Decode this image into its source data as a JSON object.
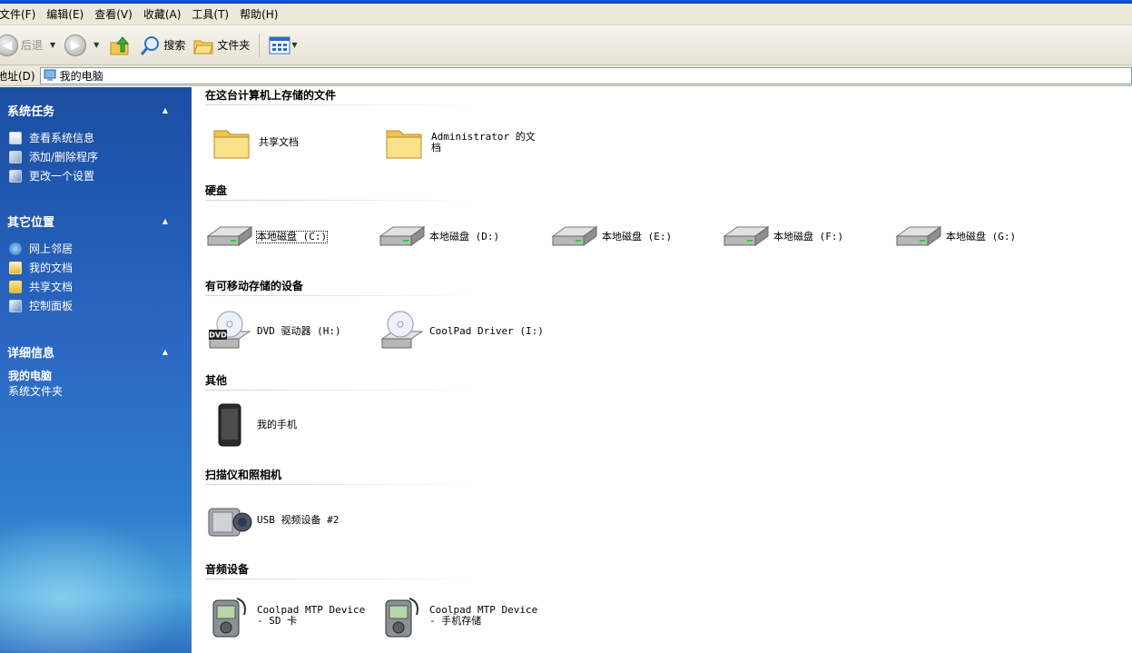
{
  "menu": [
    "文件(F)",
    "编辑(E)",
    "查看(V)",
    "收藏(A)",
    "工具(T)",
    "帮助(H)"
  ],
  "toolbar": {
    "back_label": "后退",
    "search_label": "搜索",
    "folders_label": "文件夹"
  },
  "address": {
    "label": "地址(D)",
    "value": "我的电脑"
  },
  "left_pane": {
    "system_tasks": {
      "title": "系统任务",
      "items": [
        "查看系统信息",
        "添加/删除程序",
        "更改一个设置"
      ]
    },
    "other_places": {
      "title": "其它位置",
      "items": [
        "网上邻居",
        "我的文档",
        "共享文档",
        "控制面板"
      ]
    },
    "details": {
      "title": "详细信息",
      "name": "我的电脑",
      "type": "系统文件夹"
    }
  },
  "groups": [
    {
      "title": "在这台计算机上存储的文件",
      "items": [
        "共享文档",
        "Administrator 的文档"
      ]
    },
    {
      "title": "硬盘",
      "items": [
        "本地磁盘 (C:)",
        "本地磁盘 (D:)",
        "本地磁盘 (E:)",
        "本地磁盘 (F:)",
        "本地磁盘 (G:)"
      ]
    },
    {
      "title": "有可移动存储的设备",
      "items": [
        "DVD 驱动器 (H:)",
        "CoolPad Driver (I:)"
      ]
    },
    {
      "title": "其他",
      "items": [
        "我的手机"
      ]
    },
    {
      "title": "扫描仪和照相机",
      "items": [
        "USB 视频设备 #2"
      ]
    },
    {
      "title": "音频设备",
      "items": [
        "Coolpad MTP Device - SD 卡",
        "Coolpad MTP Device - 手机存储"
      ]
    }
  ],
  "icons": {
    "folder": "folder-icon",
    "drive": "hard-drive-icon",
    "dvd": "dvd-drive-icon",
    "cd": "cd-drive-icon",
    "phone": "phone-icon",
    "camera": "camera-icon",
    "mp3": "mp3-player-icon"
  },
  "colors": {
    "pane_top": "#1a4ea2",
    "pane_mid": "#2f7dcc",
    "menu_bg": "#ece9d8",
    "group_line": "#c8d4e8"
  }
}
